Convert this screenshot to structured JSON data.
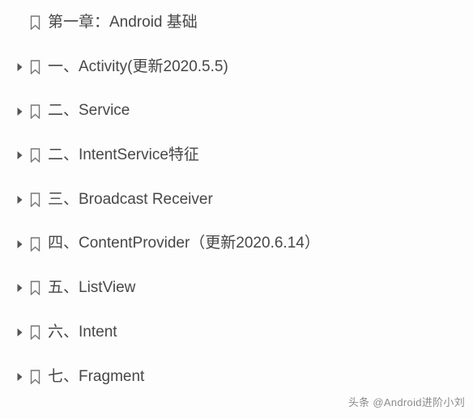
{
  "outline": {
    "items": [
      {
        "expandable": false,
        "label": "第一章：Android 基础"
      },
      {
        "expandable": true,
        "label": "一、Activity(更新2020.5.5)"
      },
      {
        "expandable": true,
        "label": "二、Service"
      },
      {
        "expandable": true,
        "label": "二、IntentService特征"
      },
      {
        "expandable": true,
        "label": "三、Broadcast Receiver"
      },
      {
        "expandable": true,
        "label": "四、ContentProvider（更新2020.6.14）"
      },
      {
        "expandable": true,
        "label": "五、ListView"
      },
      {
        "expandable": true,
        "label": "六、Intent"
      },
      {
        "expandable": true,
        "label": "七、Fragment"
      }
    ]
  },
  "watermark": "头条 @Android进阶小刘"
}
